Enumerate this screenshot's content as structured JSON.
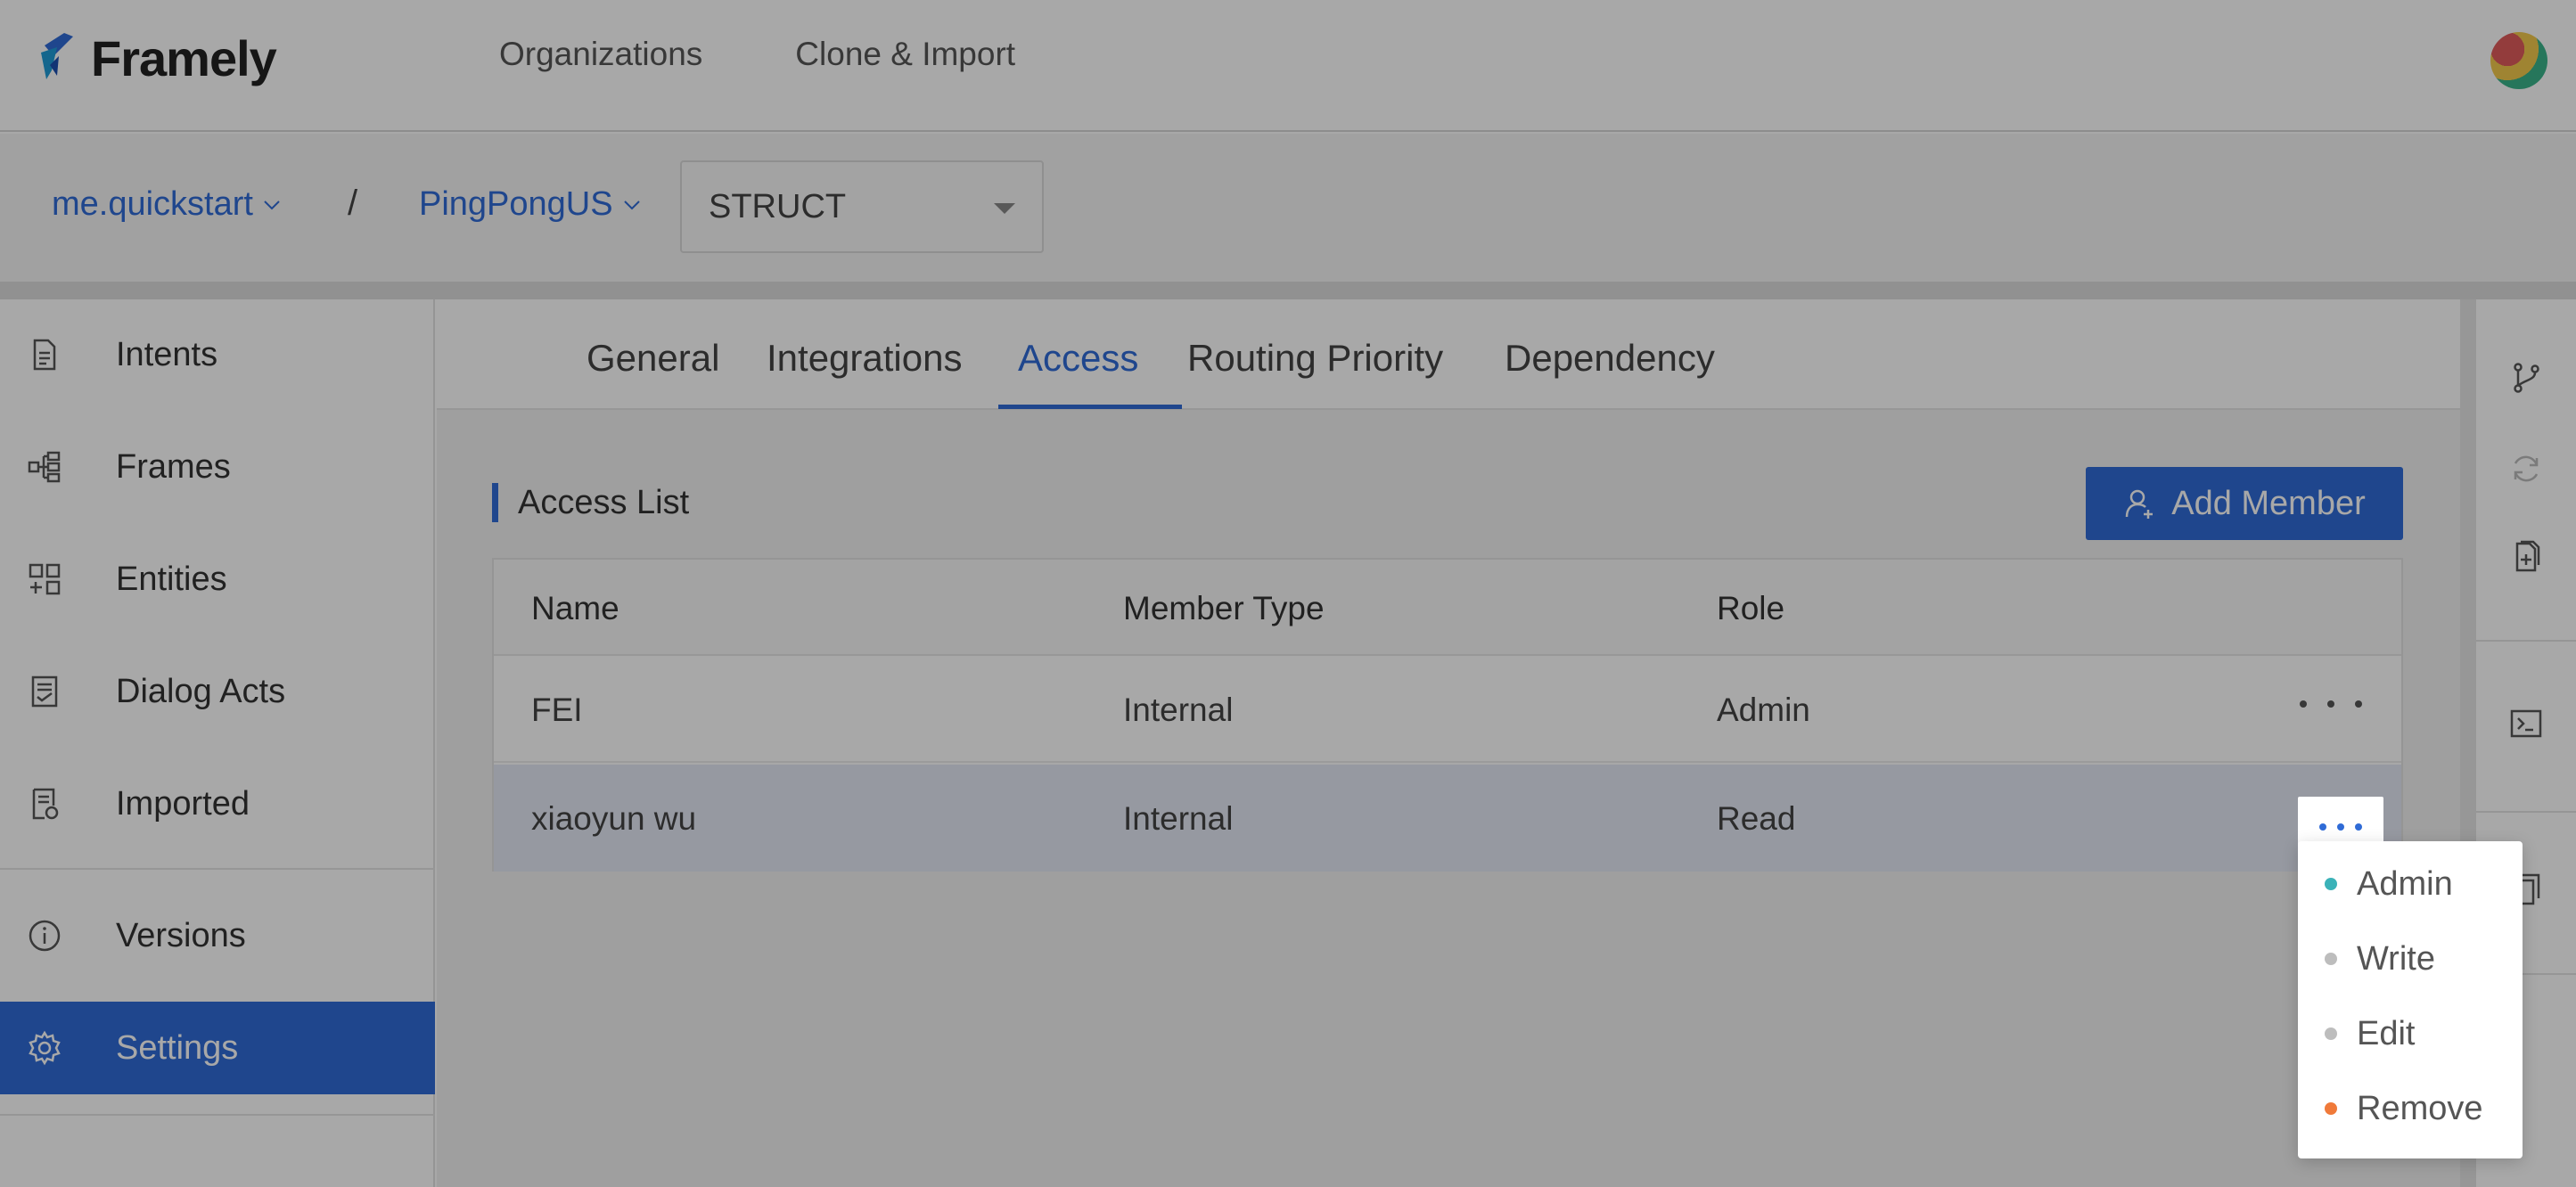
{
  "app": {
    "name": "Framely"
  },
  "topnav": {
    "items": [
      "Organizations",
      "Clone & Import"
    ]
  },
  "breadcrumb": {
    "org": "me.quickstart",
    "separator": "/",
    "project": "PingPongUS",
    "select_value": "STRUCT"
  },
  "sidebar": {
    "items": [
      {
        "label": "Intents",
        "icon": "document-icon"
      },
      {
        "label": "Frames",
        "icon": "frames-icon"
      },
      {
        "label": "Entities",
        "icon": "entities-icon"
      },
      {
        "label": "Dialog Acts",
        "icon": "dialog-acts-icon"
      },
      {
        "label": "Imported",
        "icon": "imported-icon"
      },
      {
        "label": "Versions",
        "icon": "info-icon"
      },
      {
        "label": "Settings",
        "icon": "gear-icon",
        "active": true
      }
    ]
  },
  "tabs": {
    "items": [
      "General",
      "Integrations",
      "Access",
      "Routing Priority",
      "Dependency"
    ],
    "active": "Access"
  },
  "access": {
    "title": "Access List",
    "add_button": "Add Member",
    "columns": [
      "Name",
      "Member Type",
      "Role"
    ],
    "rows": [
      {
        "name": "FEI",
        "member_type": "Internal",
        "role": "Admin"
      },
      {
        "name": "xiaoyun wu",
        "member_type": "Internal",
        "role": "Read"
      }
    ]
  },
  "dropdown": {
    "items": [
      {
        "label": "Admin",
        "color": "#3bb2b8"
      },
      {
        "label": "Write",
        "color": "#bdbdbd"
      },
      {
        "label": "Edit",
        "color": "#bdbdbd"
      },
      {
        "label": "Remove",
        "color": "#f07a3a"
      }
    ]
  },
  "colors": {
    "accent": "#2f6bd6",
    "overlay": "rgba(0,0,0,0.34)"
  }
}
